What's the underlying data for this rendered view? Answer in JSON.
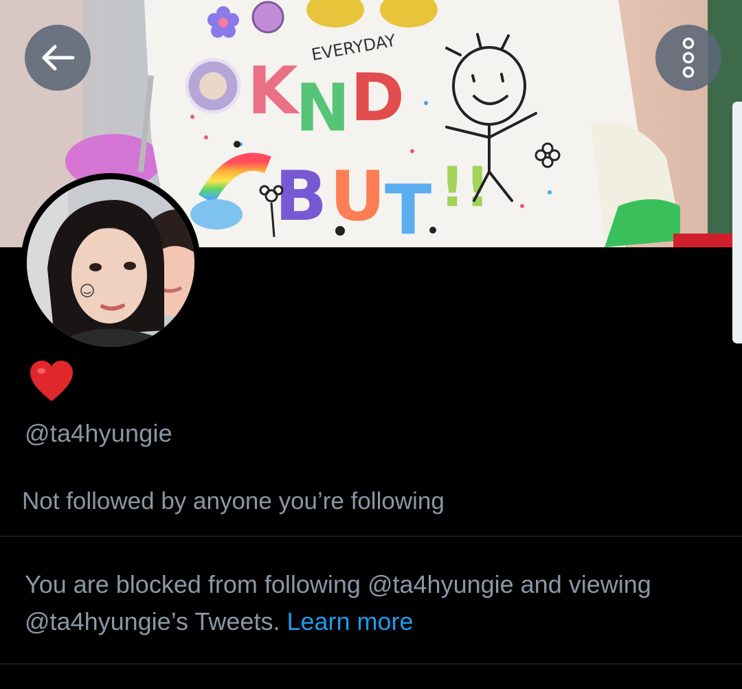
{
  "header": {
    "back_icon": "arrow-left-icon",
    "more_icon": "more-vertical-icon"
  },
  "banner": {
    "shirt_text_top": "EVERYDAY",
    "shirt_text_line1": "KIND",
    "shirt_text_line2": "BUT!!"
  },
  "profile": {
    "display_name_emoji": "❤️",
    "handle": "@ta4hyungie",
    "followers_note": "Not followed by anyone you’re following"
  },
  "blocked": {
    "message": "You are blocked from following @ta4hyungie and viewing @ta4hyungie’s Tweets.",
    "learn_more": "Learn more"
  },
  "colors": {
    "background": "#000000",
    "secondary_text": "#8b98a5",
    "link": "#1d9bf0",
    "divider": "#2f3336"
  }
}
